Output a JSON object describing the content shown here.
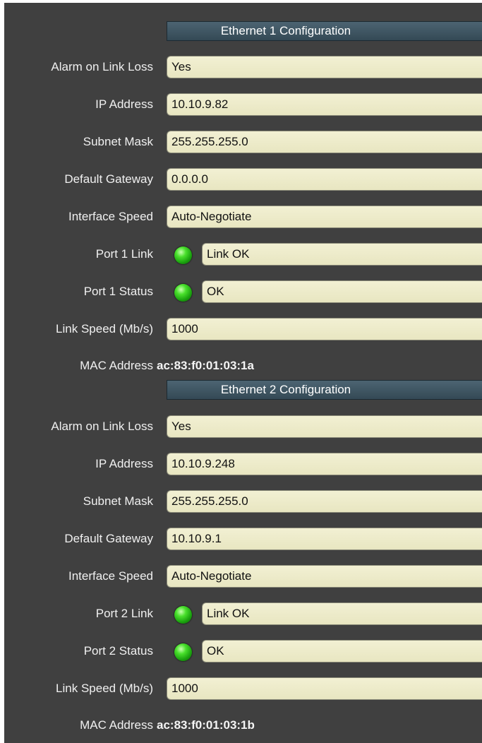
{
  "ethernet1": {
    "header": "Ethernet 1 Configuration",
    "alarm_label": "Alarm on Link Loss",
    "alarm_value": "Yes",
    "ip_label": "IP Address",
    "ip_value": "10.10.9.82",
    "subnet_label": "Subnet Mask",
    "subnet_value": "255.255.255.0",
    "gateway_label": "Default Gateway",
    "gateway_value": "0.0.0.0",
    "speed_label": "Interface Speed",
    "speed_value": "Auto-Negotiate",
    "port_link_label": "Port 1 Link",
    "port_link_value": "Link OK",
    "port_status_label": "Port 1 Status",
    "port_status_value": "OK",
    "link_speed_label": "Link Speed (Mb/s)",
    "link_speed_value": "1000",
    "mac_label": "MAC Address",
    "mac_value": "ac:83:f0:01:03:1a"
  },
  "ethernet2": {
    "header": "Ethernet 2 Configuration",
    "alarm_label": "Alarm on Link Loss",
    "alarm_value": "Yes",
    "ip_label": "IP Address",
    "ip_value": "10.10.9.248",
    "subnet_label": "Subnet Mask",
    "subnet_value": "255.255.255.0",
    "gateway_label": "Default Gateway",
    "gateway_value": "10.10.9.1",
    "speed_label": "Interface Speed",
    "speed_value": "Auto-Negotiate",
    "port_link_label": "Port 2 Link",
    "port_link_value": "Link OK",
    "port_status_label": "Port 2 Status",
    "port_status_value": "OK",
    "link_speed_label": "Link Speed (Mb/s)",
    "link_speed_value": "1000",
    "mac_label": "MAC Address",
    "mac_value": "ac:83:f0:01:03:1b"
  },
  "icons": {
    "status_led": "green-led-icon"
  },
  "colors": {
    "background": "#404040",
    "header": "#3c5462",
    "field": "#eeecca",
    "led_ok": "#2fc41a"
  }
}
